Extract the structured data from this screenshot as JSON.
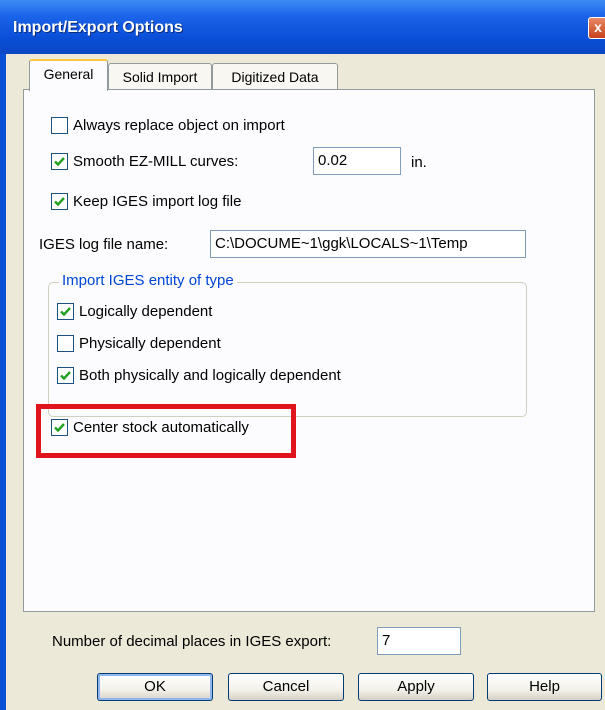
{
  "window": {
    "title": "Import/Export Options",
    "close_glyph": "x"
  },
  "tabs": [
    {
      "label": "General",
      "active": true
    },
    {
      "label": "Solid Import",
      "active": false
    },
    {
      "label": "Digitized Data",
      "active": false
    }
  ],
  "general": {
    "always_replace": {
      "label": "Always replace object on import",
      "checked": false
    },
    "smooth_curves": {
      "label": "Smooth EZ-MILL curves:",
      "checked": true,
      "value": "0.02",
      "unit": "in."
    },
    "keep_log": {
      "label": "Keep IGES import log file",
      "checked": true
    },
    "log_file": {
      "label": "IGES log file name:",
      "value": "C:\\DOCUME~1\\ggk\\LOCALS~1\\Temp"
    },
    "entity_group": {
      "title": "Import IGES entity of type",
      "logically": {
        "label": "Logically dependent",
        "checked": true
      },
      "physically": {
        "label": "Physically dependent",
        "checked": false
      },
      "both": {
        "label": "Both physically and logically dependent",
        "checked": true
      }
    },
    "center_stock": {
      "label": "Center stock automatically",
      "checked": true
    },
    "decimal_places": {
      "label": "Number of decimal places in IGES export:",
      "value": "7"
    }
  },
  "buttons": {
    "ok": "OK",
    "cancel": "Cancel",
    "apply": "Apply",
    "help": "Help"
  },
  "colors": {
    "highlight": "#e0141b",
    "titlebar": "#0a4fd8",
    "checkmark": "#21a121"
  },
  "icons": {
    "checked": "checkmark-icon",
    "close": "close-icon"
  }
}
